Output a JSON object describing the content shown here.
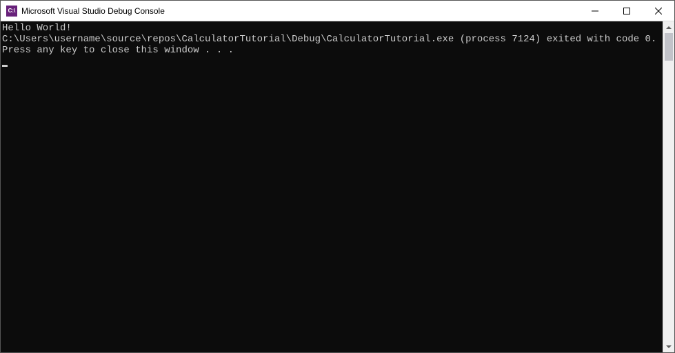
{
  "window": {
    "icon_text": "C:\\",
    "title": "Microsoft Visual Studio Debug Console"
  },
  "console": {
    "line1": "Hello World!",
    "line2": "",
    "line3": "C:\\Users\\username\\source\\repos\\CalculatorTutorial\\Debug\\CalculatorTutorial.exe (process 7124) exited with code 0.",
    "line4": "Press any key to close this window . . ."
  }
}
